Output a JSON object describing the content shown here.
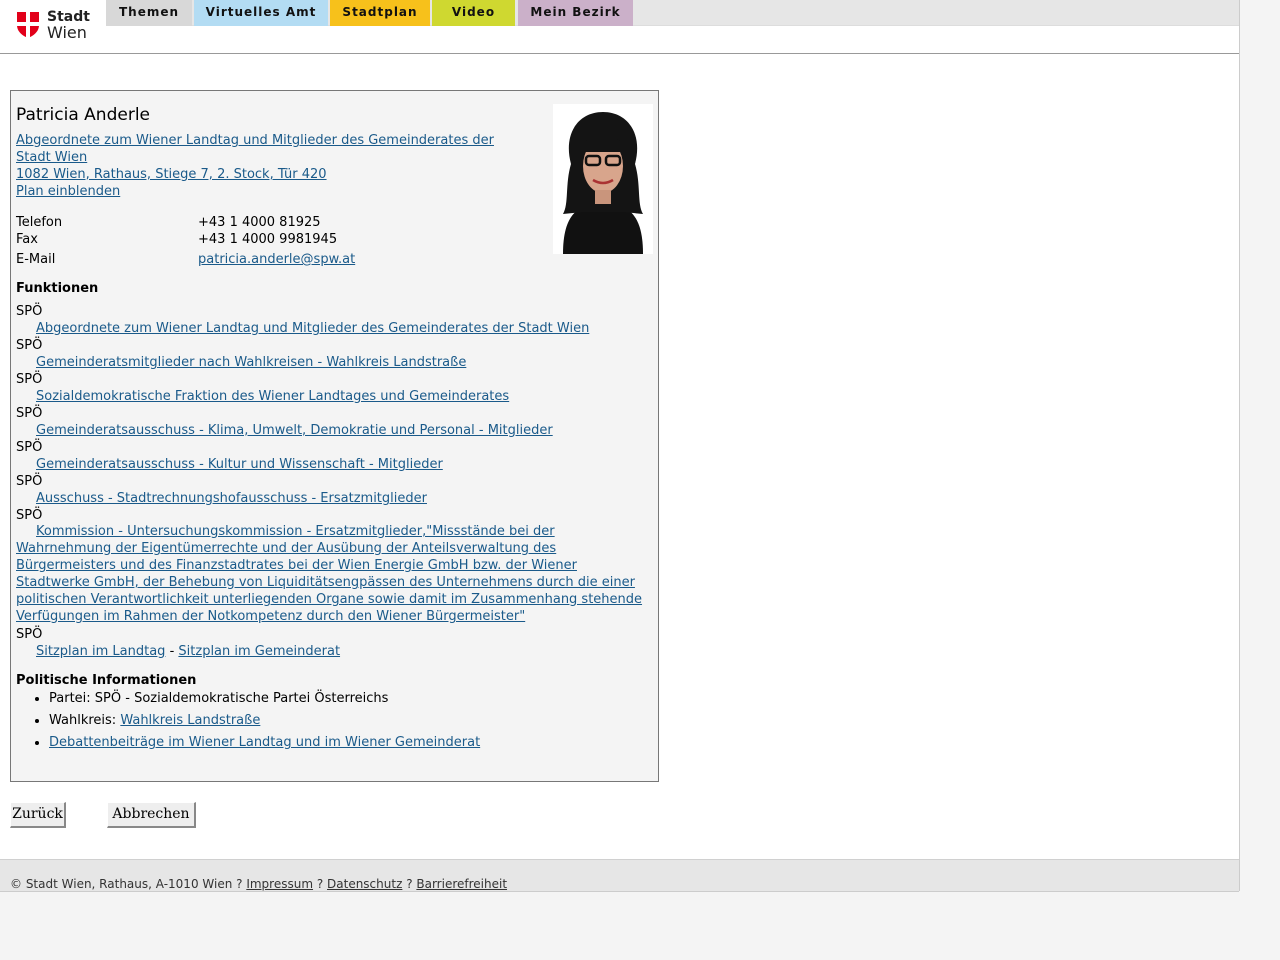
{
  "logo": {
    "line1": "Stadt",
    "line2": "Wien"
  },
  "nav": {
    "tabs": [
      {
        "label": "Themen"
      },
      {
        "label": "Virtuelles Amt"
      },
      {
        "label": "Stadtplan"
      },
      {
        "label": "Video"
      },
      {
        "label": "Mein Bezirk"
      }
    ]
  },
  "person": {
    "name": "Patricia Anderle",
    "role_line1": "Abgeordnete zum Wiener Landtag und Mitglieder des Gemeinderates der",
    "role_line2": "Stadt Wien ",
    "address": "1082 Wien, Rathaus, Stiege 7, 2. Stock, Tür 420",
    "plan_link": "Plan einblenden",
    "contact": {
      "phone_label": "Telefon",
      "phone": "+43 1 4000 81925",
      "fax_label": "Fax",
      "fax": "+43 1 4000 9981945",
      "email_label": "E-Mail",
      "email": "patricia.anderle@spw.at"
    }
  },
  "functions": {
    "heading": "Funktionen",
    "party": "SPÖ",
    "items": [
      "Abgeordnete zum Wiener Landtag und Mitglieder des Gemeinderates der Stadt Wien",
      "Gemeinderatsmitglieder nach Wahlkreisen - Wahlkreis Landstraße",
      "Sozialdemokratische Fraktion des Wiener Landtages und Gemeinderates",
      "Gemeinderatsausschuss - Klima, Umwelt, Demokratie und Personal - Mitglieder",
      "Gemeinderatsausschuss - Kultur und Wissenschaft - Mitglieder",
      "Ausschuss - Stadtrechnungshofausschuss - Ersatzmitglieder",
      "Kommission - Untersuchungskommission - Ersatzmitglieder,\"Missstände bei der Wahrnehmung der Eigentümerrechte und der Ausübung der Anteilsverwaltung des Bürgermeisters und des Finanzstadtrates bei der Wien Energie GmbH bzw. der Wiener Stadtwerke GmbH, der Behebung von Liquiditätsengpässen des Unternehmens durch die einer politischen Verantwortlichkeit unterliegenden Organe sowie damit im Zusammenhang stehende Verfügungen im Rahmen der Notkompetenz durch den Wiener Bürgermeister\""
    ],
    "seat_landtag": "Sitzplan im Landtag",
    "seat_sep": "-",
    "seat_gemeinderat": "Sitzplan im Gemeinderat"
  },
  "political": {
    "heading": "Politische Informationen",
    "party_text": "Partei: SPÖ - Sozialdemokratische Partei Österreichs",
    "district_label": "Wahlkreis: ",
    "district_link": "Wahlkreis Landstraße",
    "debate_link": "Debattenbeiträge im Wiener Landtag und im Wiener Gemeinderat"
  },
  "buttons": {
    "back": "Zurück",
    "cancel": "Abbrechen"
  },
  "footer": {
    "copyright": "© Stadt Wien, Rathaus, A-1010 Wien ? ",
    "impressum": "Impressum",
    "sep": " ? ",
    "datenschutz": "Datenschutz",
    "barrierefreiheit": "Barrierefreiheit"
  }
}
